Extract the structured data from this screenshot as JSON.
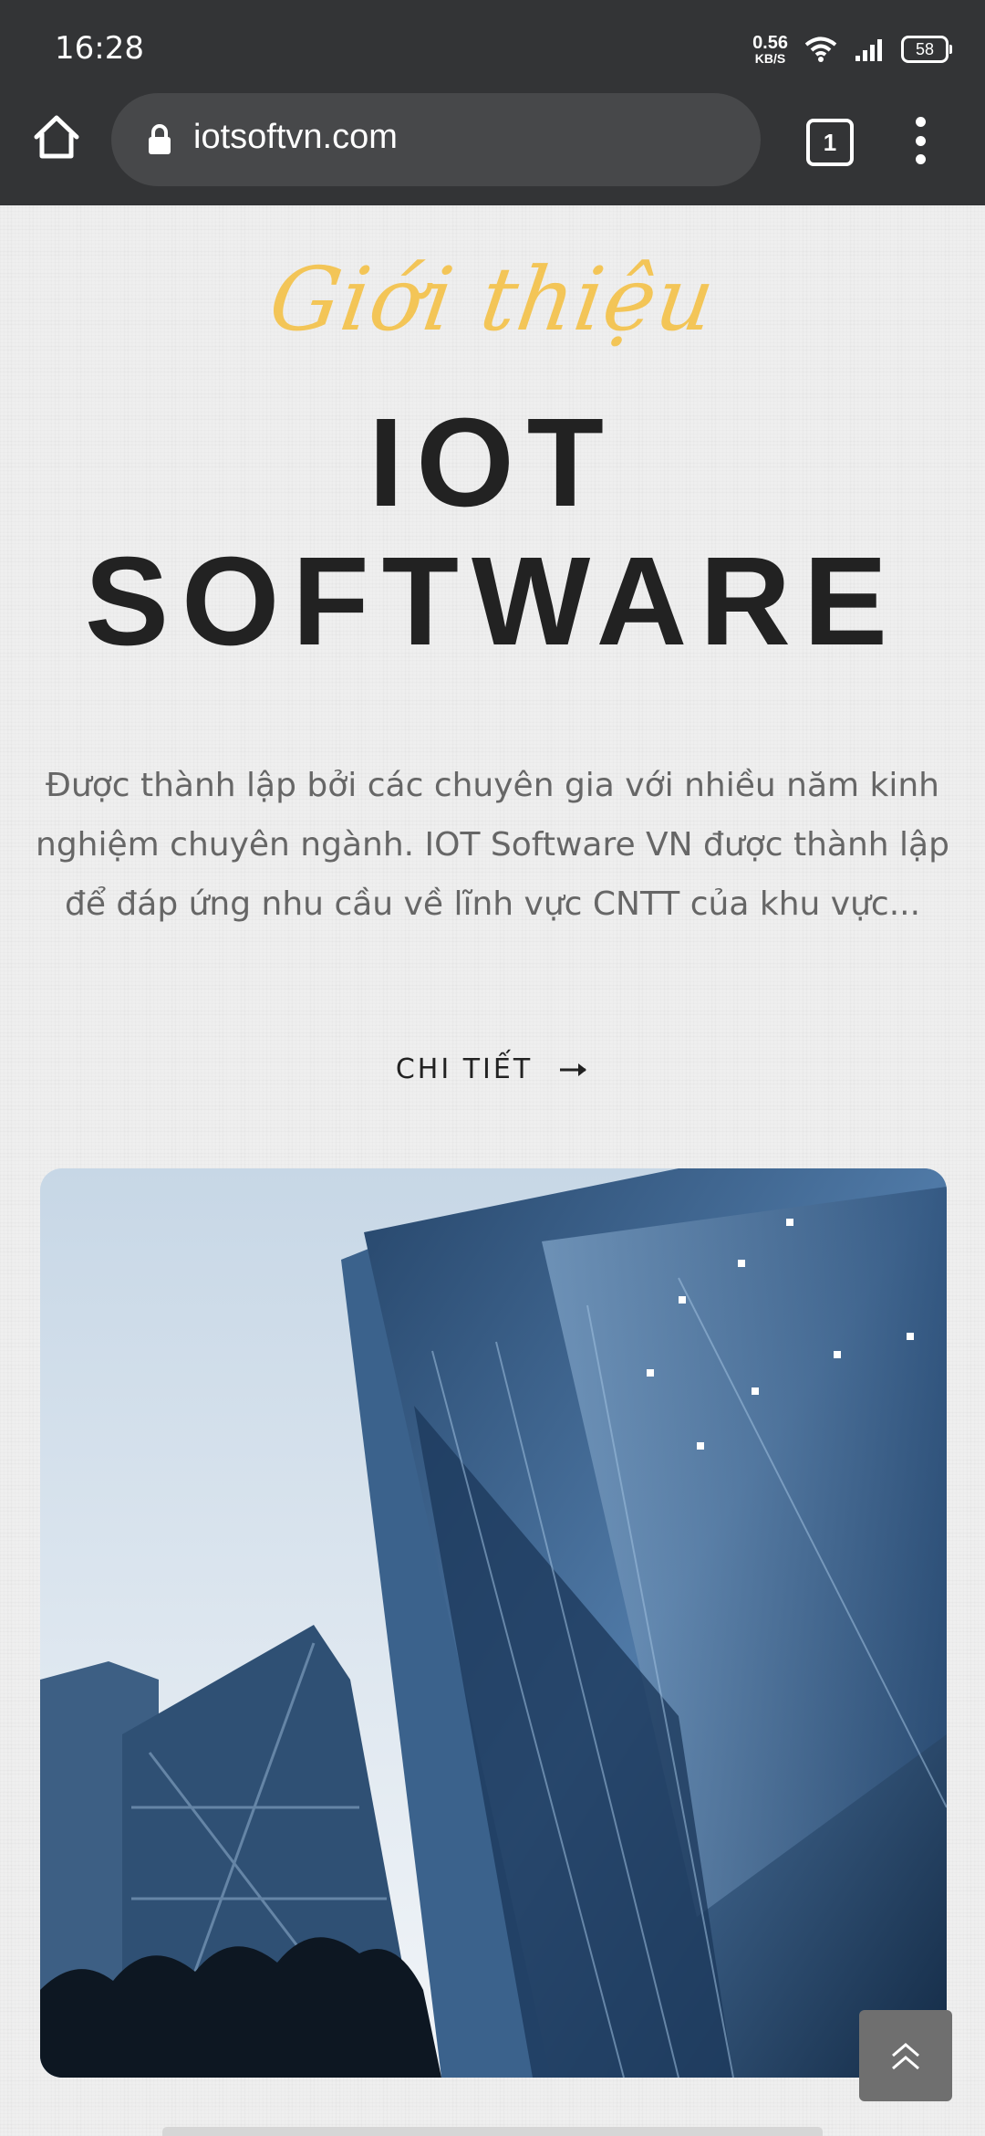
{
  "status_bar": {
    "time": "16:28",
    "net_speed_value": "0.56",
    "net_speed_unit": "KB/S",
    "battery": "58"
  },
  "browser": {
    "url": "iotsoftvn.com",
    "tab_count": "1"
  },
  "hero": {
    "script_title": "Giới thiệu",
    "title_line1": "IOT",
    "title_line2": "SOFTWARE",
    "description": "Được thành lập bởi các chuyên gia với nhiều năm kinh nghiệm chuyên ngành. IOT Software VN được thành lập  để đáp ứng nhu cầu về lĩnh vực CNTT của khu vực...",
    "detail_label": "CHI TIẾT"
  },
  "icons": {
    "home": "home-icon",
    "lock": "lock-icon",
    "tabs": "tab-switcher-icon",
    "menu": "more-vert-icon",
    "arrow": "arrow-right-icon",
    "scroll_top": "double-chevron-up-icon"
  },
  "colors": {
    "accent_gold": "#f3c557",
    "title_dark": "#222222",
    "chrome_bg": "#333436"
  }
}
